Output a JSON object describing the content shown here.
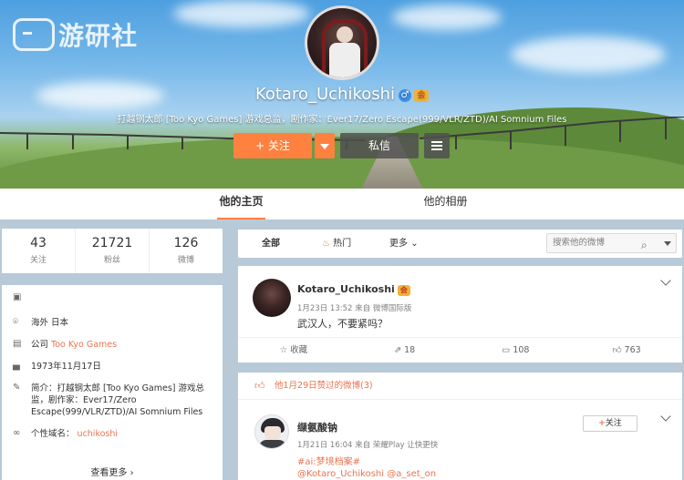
{
  "watermark": {
    "text": "游研社"
  },
  "profile": {
    "username": "Kotaro_Uchikoshi",
    "gender_icon": "♂",
    "vip_badge": "会",
    "bio": "打越钢太郎 [Too Kyo Games] 游戏总监，剧作家：Ever17/Zero Escape(999/VLR/ZTD)/AI Somnium Files",
    "follow_label": "+ 关注",
    "message_label": "私信"
  },
  "tabs": [
    {
      "label": "他的主页"
    },
    {
      "label": "他的相册"
    }
  ],
  "stats": [
    {
      "value": "43",
      "label": "关注"
    },
    {
      "value": "21721",
      "label": "粉丝"
    },
    {
      "value": "126",
      "label": "微博"
    }
  ],
  "info": {
    "location": "海外 日本",
    "company_prefix": "公司",
    "company": "Too Kyo Games",
    "birthday": "1973年11月17日",
    "intro_prefix": "简介：",
    "intro": "打越钢太郎 [Too Kyo Games] 游戏总监，剧作家：Ever17/Zero Escape(999/VLR/ZTD)/AI Somnium Files",
    "domain_label": "个性域名：",
    "domain": "uchikoshi",
    "see_more": "查看更多 ›"
  },
  "feed_bar": {
    "all": "全部",
    "hot": "热门",
    "more": "更多",
    "search_placeholder": "搜索他的微博"
  },
  "post": {
    "author": "Kotaro_Uchikoshi",
    "vip_badge": "会",
    "meta": "1月23日 13:52 来自 微博国际版",
    "text": "武汉人，不要紧吗？",
    "actions": {
      "favorite": "收藏",
      "repost": "18",
      "comment": "108",
      "like": "763"
    }
  },
  "liked": {
    "header": "他1月29日赞过的微博(3)",
    "author": "缬氨酸钠",
    "meta": "1月21日 16:04 来自 荣耀Play 让快更快",
    "tag": "#ai:梦境档案#",
    "mention": "@Kotaro_Uchikoshi @a_set_on",
    "follow_label": "关注",
    "follow_plus": "+"
  },
  "colors": {
    "accent": "#ff8140",
    "link": "#eb7350",
    "page_bg": "#b8c9d8"
  }
}
